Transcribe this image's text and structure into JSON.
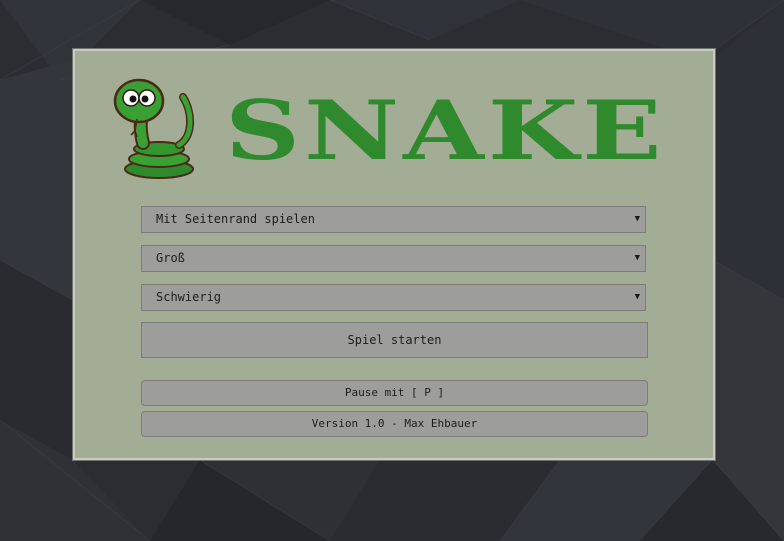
{
  "background": {
    "color": "#2b2d33",
    "panel_color": "#a3ac94",
    "accent": "#2e8a2c"
  },
  "header": {
    "logo_icon": "snake-mascot-icon",
    "title": "SNAKE"
  },
  "menu": {
    "border_mode": {
      "selected": "Mit Seitenrand spielen",
      "caret": "▼"
    },
    "field_size": {
      "selected": "Groß",
      "caret": "▼"
    },
    "difficulty": {
      "selected": "Schwierig",
      "caret": "▼"
    },
    "start_button": "Spiel starten"
  },
  "footer": {
    "pause_hint": "Pause mit [ P ]",
    "version": "Version 1.0 - Max Ehbauer"
  }
}
